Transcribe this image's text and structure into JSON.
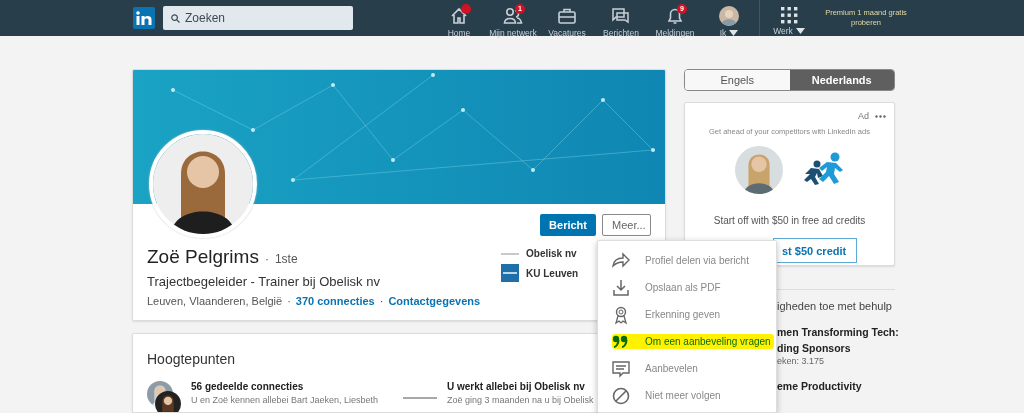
{
  "nav": {
    "search_placeholder": "Zoeken",
    "items": [
      {
        "label": "Home",
        "badge": {
          "kind": "dot"
        },
        "dropdown": false
      },
      {
        "label": "Mijn netwerk",
        "badge": {
          "kind": "count",
          "text": "1"
        },
        "dropdown": false
      },
      {
        "label": "Vacatures",
        "dropdown": false
      },
      {
        "label": "Berichten",
        "dropdown": false
      },
      {
        "label": "Meldingen",
        "badge": {
          "kind": "count",
          "text": "9"
        },
        "dropdown": false
      },
      {
        "label": "Ik",
        "dropdown": true
      },
      {
        "label": "Werk",
        "dropdown": true
      }
    ],
    "premium": "Premium 1 maand gratis proberen"
  },
  "profile": {
    "name": "Zoë Pelgrims",
    "degree_separator": "·",
    "degree": "1ste",
    "meta_separators": [
      "·",
      "·"
    ],
    "headline": "Trajectbegeleider - Trainer bij Obelisk nv",
    "location": "Leuven, Vlaanderen, België",
    "connections": "370 connecties",
    "contact": "Contactgegevens",
    "buttons": [
      {
        "label": "Bericht",
        "kind": "primary"
      },
      {
        "label": "Meer...",
        "kind": "secondary"
      }
    ],
    "experience": [
      {
        "name": "Obelisk nv"
      },
      {
        "name": "KU Leuven"
      }
    ]
  },
  "highlights": {
    "title": "Hoogtepunten",
    "items": [
      {
        "title": "56 gedeelde connecties",
        "text": "U en Zoë kennen allebei Bart Jaeken, Liesbeth"
      },
      {
        "title": "U werkt allebei bij Obelisk nv",
        "text": "Zoë ging 3 maanden na u bij Obelisk"
      }
    ]
  },
  "language_toggle": [
    {
      "label": "Engels",
      "selected": false
    },
    {
      "label": "Nederlands",
      "selected": true
    }
  ],
  "ad": {
    "label": "Ad",
    "tagline": "Get ahead of your competitors with LinkedIn ads",
    "offer": "Start off with $50 in free ad credits",
    "button": "st $50 credit"
  },
  "side_fragments": [
    {
      "kind": "text",
      "text": "igheden toe met behulp"
    },
    {
      "kind": "title",
      "text": "men Transforming Tech:"
    },
    {
      "kind": "title",
      "text": "ding Sponsors"
    },
    {
      "kind": "meta",
      "text": "eken: 3.175"
    },
    {
      "kind": "title",
      "text": "eme Productivity"
    }
  ],
  "more_menu": [
    {
      "label": "Profiel delen via bericht",
      "highlighted": false
    },
    {
      "label": "Opslaan als PDF",
      "highlighted": false
    },
    {
      "label": "Erkenning geven",
      "highlighted": false
    },
    {
      "label": "Om een aanbeveling vragen",
      "highlighted": true
    },
    {
      "label": "Aanbevelen",
      "highlighted": false
    },
    {
      "label": "Niet meer volgen",
      "highlighted": false
    }
  ]
}
